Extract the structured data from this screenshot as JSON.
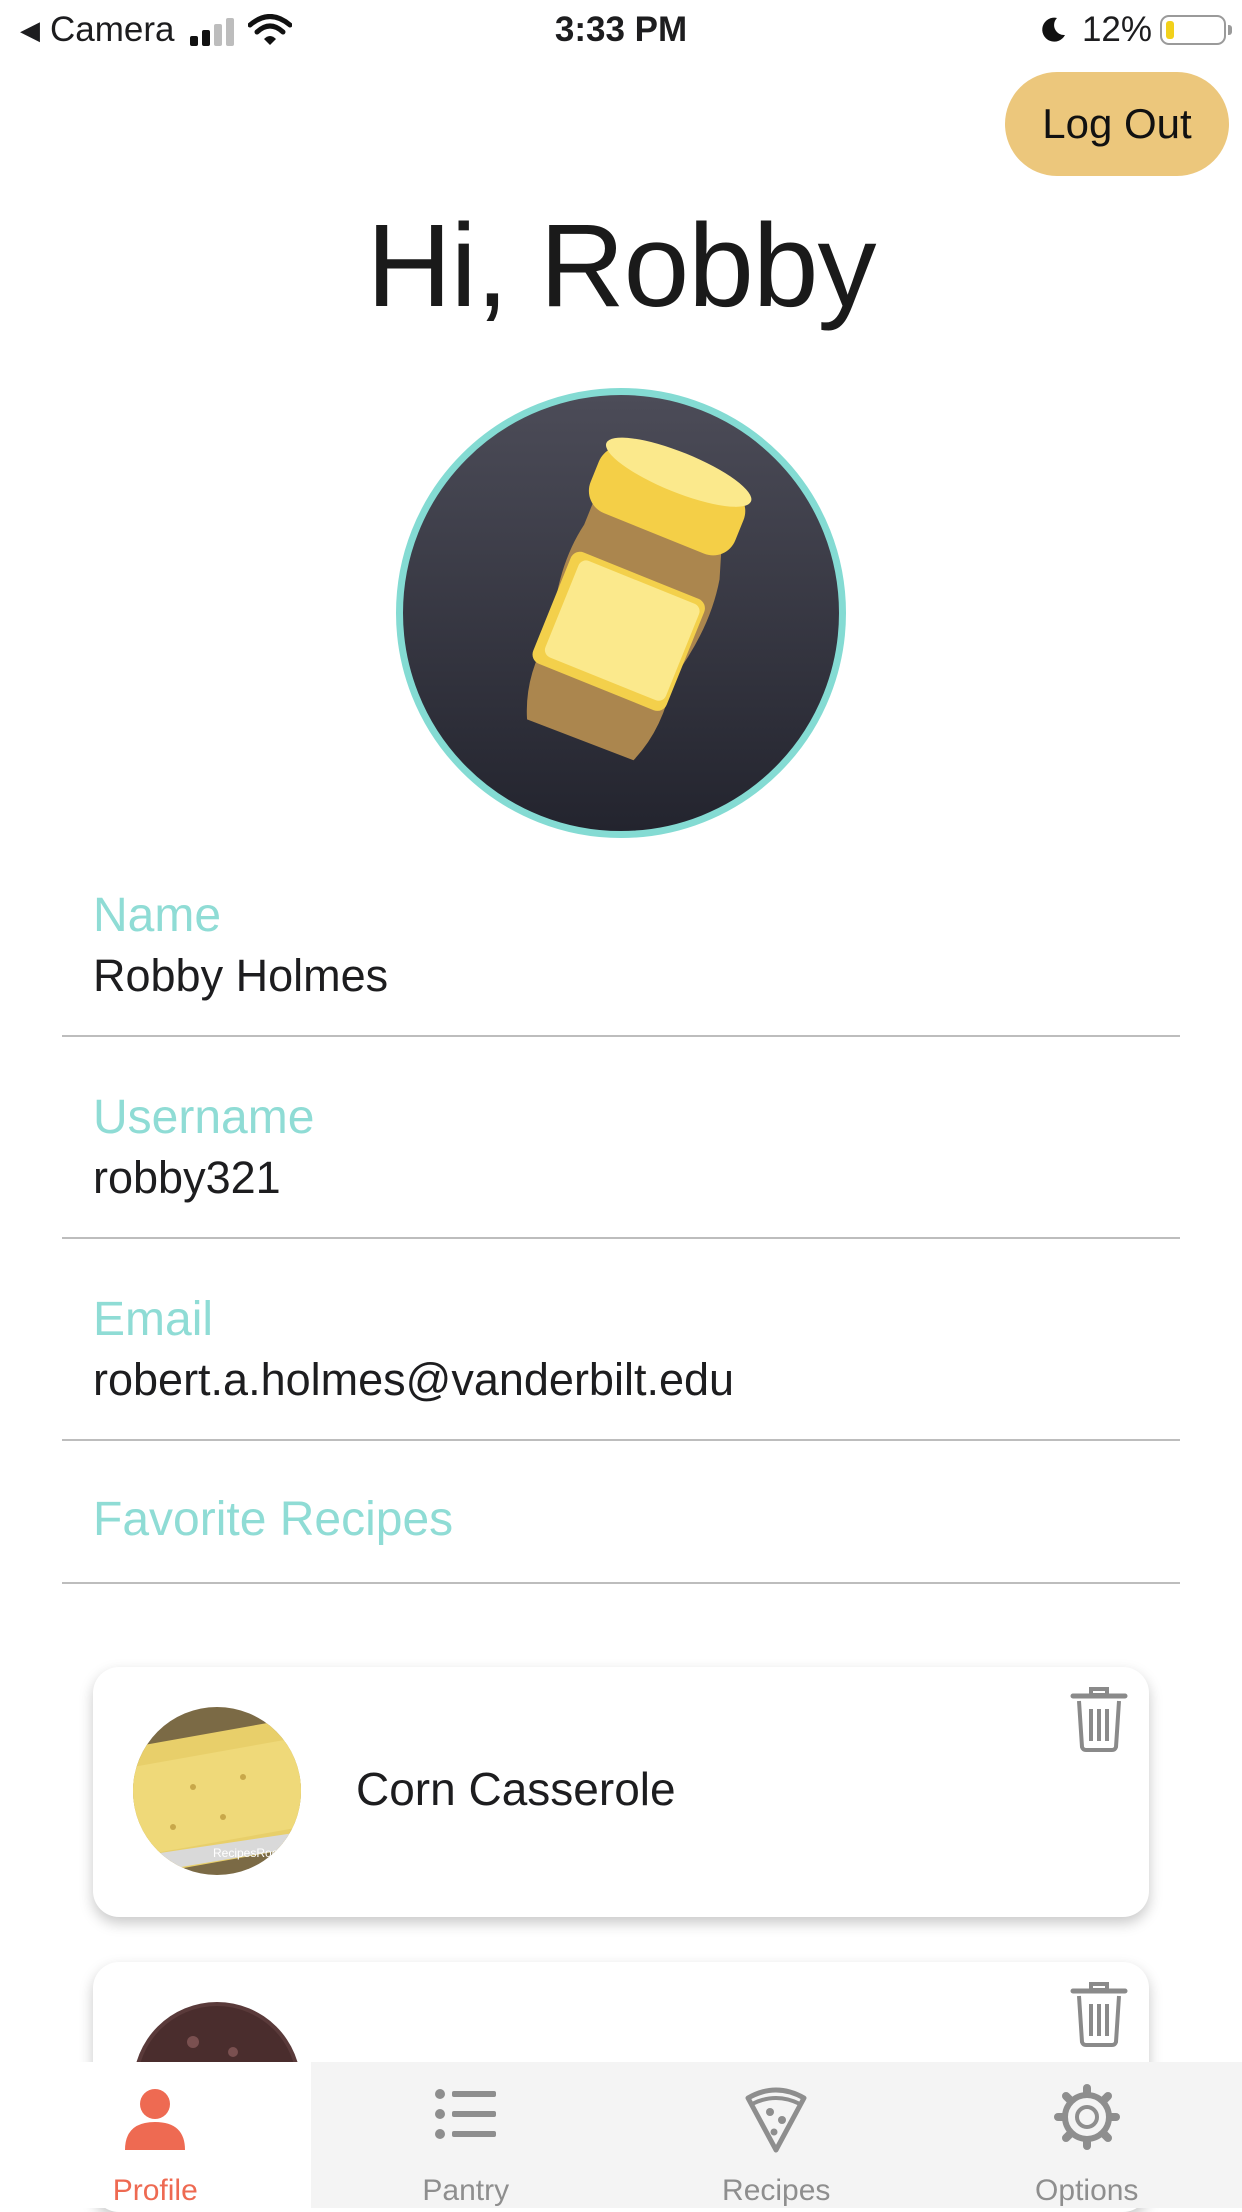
{
  "status_bar": {
    "back_app": "Camera",
    "time": "3:33 PM",
    "battery_text": "12%",
    "battery_level": 0.12,
    "cell_signal_bars": 2
  },
  "header": {
    "logout_label": "Log Out",
    "greeting": "Hi, Robby"
  },
  "profile": {
    "avatar_icon": "peanut-butter-jar-icon",
    "fields": [
      {
        "label": "Name",
        "value": "Robby Holmes"
      },
      {
        "label": "Username",
        "value": "robby321"
      },
      {
        "label": "Email",
        "value": "robert.a.holmes@vanderbilt.edu"
      }
    ],
    "favorites_label": "Favorite Recipes"
  },
  "favorites": [
    {
      "title": "Corn Casserole",
      "thumb_caption": "RecipesRoo",
      "icon": "trash-icon"
    },
    {
      "title": "",
      "icon": "trash-icon"
    }
  ],
  "tabbar": {
    "items": [
      {
        "label": "Profile",
        "icon": "person-icon",
        "active": true
      },
      {
        "label": "Pantry",
        "icon": "list-icon",
        "active": false
      },
      {
        "label": "Recipes",
        "icon": "pizza-slice-icon",
        "active": false
      },
      {
        "label": "Options",
        "icon": "gear-icon",
        "active": false
      }
    ]
  },
  "colors": {
    "accent_teal": "#8fdcd5",
    "logout_bg": "#ecc77c",
    "active_tab": "#ee6a52"
  }
}
